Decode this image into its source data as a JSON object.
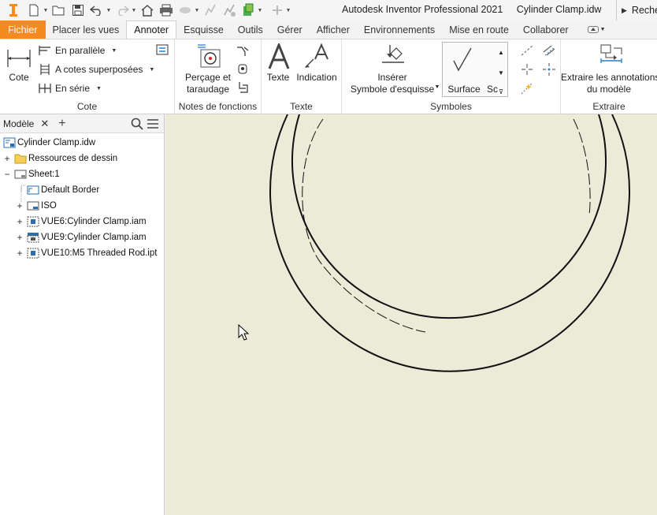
{
  "quick_access": {
    "icons": [
      "inventor-logo-icon",
      "new-icon",
      "open-icon",
      "save-icon",
      "undo-icon",
      "redo-icon",
      "home-icon",
      "print-icon",
      "measure-icon",
      "update-icon",
      "appearance-icon",
      "add-icon"
    ]
  },
  "window": {
    "app_title": "Autodesk Inventor Professional 2021",
    "doc_title": "Cylinder Clamp.idw",
    "search_label": "Reche"
  },
  "tabs": [
    {
      "label": "Fichier",
      "active": false
    },
    {
      "label": "Placer les vues",
      "active": false
    },
    {
      "label": "Annoter",
      "active": true
    },
    {
      "label": "Esquisse",
      "active": false
    },
    {
      "label": "Outils",
      "active": false
    },
    {
      "label": "Gérer",
      "active": false
    },
    {
      "label": "Afficher",
      "active": false
    },
    {
      "label": "Environnements",
      "active": false
    },
    {
      "label": "Mise en route",
      "active": false
    },
    {
      "label": "Collaborer",
      "active": false
    }
  ],
  "ribbon": {
    "cote_panel": {
      "title": "Cote",
      "cote_label": "Cote",
      "parallel_label": "En parallèle",
      "superposed_label": "A cotes superposées",
      "series_label": "En série"
    },
    "notes_panel": {
      "title": "Notes de fonctions",
      "hole_label_1": "Perçage et",
      "hole_label_2": "taraudage"
    },
    "texte_panel": {
      "title": "Texte",
      "text_label": "Texte",
      "leader_label": "Indication"
    },
    "symboles_panel": {
      "title": "Symboles",
      "insert_label_1": "Insérer",
      "insert_label_2": "Symbole d'esquisse",
      "surface_label": "Surface",
      "weld_label": "Sc"
    },
    "extraire_panel": {
      "title": "Extraire",
      "retrieve_label_1": "Extraire les annotations",
      "retrieve_label_2": "du modèle"
    }
  },
  "browser": {
    "title": "Modèle",
    "nodes": [
      {
        "label": "Cylinder Clamp.idw",
        "expander": ""
      },
      {
        "label": "Ressources de dessin",
        "expander": "+"
      },
      {
        "label": "Sheet:1",
        "expander": "−"
      },
      {
        "label": "Default Border",
        "expander": ""
      },
      {
        "label": "ISO",
        "expander": "+"
      },
      {
        "label": "VUE6:Cylinder Clamp.iam",
        "expander": "+"
      },
      {
        "label": "VUE9:Cylinder Clamp.iam",
        "expander": "+"
      },
      {
        "label": "VUE10:M5 Threaded Rod.ipt",
        "expander": "+"
      }
    ]
  },
  "colors": {
    "file_tab": "#f48a20",
    "canvas": "#ecebd7",
    "accent_blue": "#2a7fd4"
  }
}
